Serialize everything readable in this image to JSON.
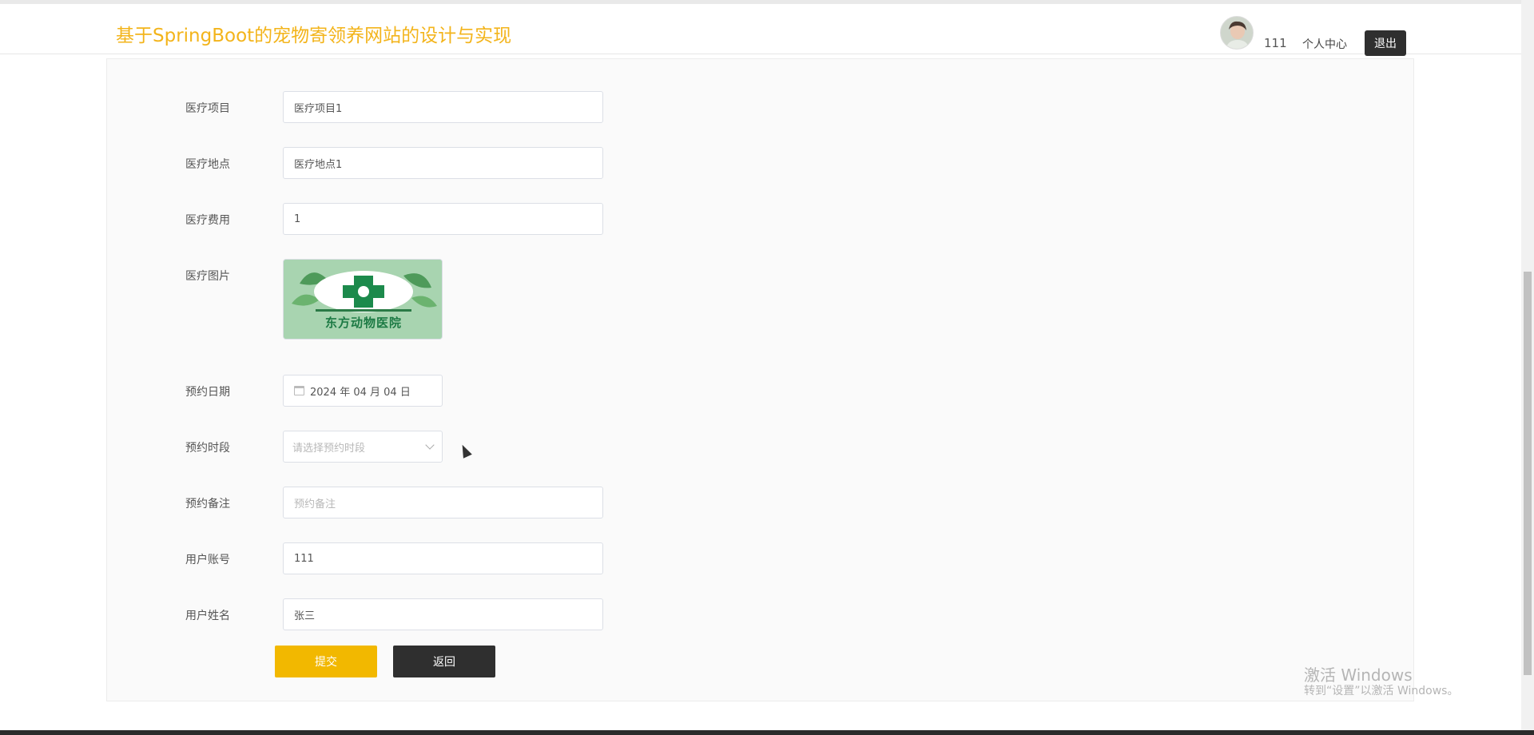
{
  "header": {
    "site_title": "基于SpringBoot的宠物寄领养网站的设计与实现",
    "username": "111",
    "profile_link": "个人中心",
    "logout_label": "退出"
  },
  "form": {
    "medical_item": {
      "label": "医疗项目",
      "value": "医疗项目1"
    },
    "medical_location": {
      "label": "医疗地点",
      "value": "医疗地点1"
    },
    "medical_fee": {
      "label": "医疗费用",
      "value": "1"
    },
    "medical_image": {
      "label": "医疗图片",
      "image_caption": "东方动物医院"
    },
    "appointment_date": {
      "label": "预约日期",
      "value": "2024 年 04 月 04 日"
    },
    "appointment_slot": {
      "label": "预约时段",
      "placeholder": "请选择预约时段"
    },
    "appointment_note": {
      "label": "预约备注",
      "placeholder": "预约备注"
    },
    "user_account": {
      "label": "用户账号",
      "value": "111"
    },
    "user_name": {
      "label": "用户姓名",
      "value": "张三"
    },
    "submit_label": "提交",
    "back_label": "返回"
  },
  "watermark": {
    "title": "激活 Windows",
    "subtitle": "转到“设置”以激活 Windows。"
  },
  "colors": {
    "brand": "#f3b41b",
    "submit": "#f2b800",
    "dark_button": "#2f2f2f"
  }
}
